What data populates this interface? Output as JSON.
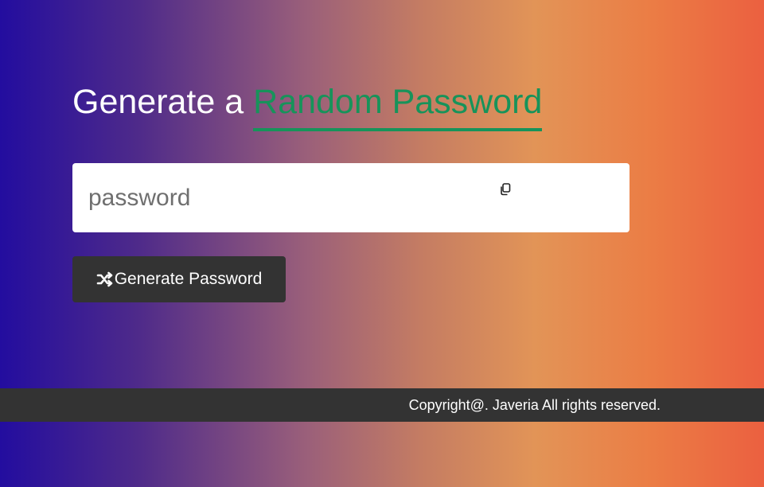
{
  "header": {
    "title_prefix": "Generate a",
    "title_accent": "Random Password"
  },
  "password_field": {
    "value": "",
    "placeholder": "password"
  },
  "copy_icon": "copy-icon",
  "generate_button": {
    "label": "Generate Password",
    "icon": "shuffle-icon"
  },
  "footer": {
    "text": "Copyright@. Javeria All rights reserved."
  },
  "colors": {
    "accent": "#17935a",
    "button_bg": "#333333",
    "footer_bg": "#333333",
    "gradient_start": "#230d9f",
    "gradient_mid": "#e29457",
    "gradient_end": "#eb6040"
  }
}
